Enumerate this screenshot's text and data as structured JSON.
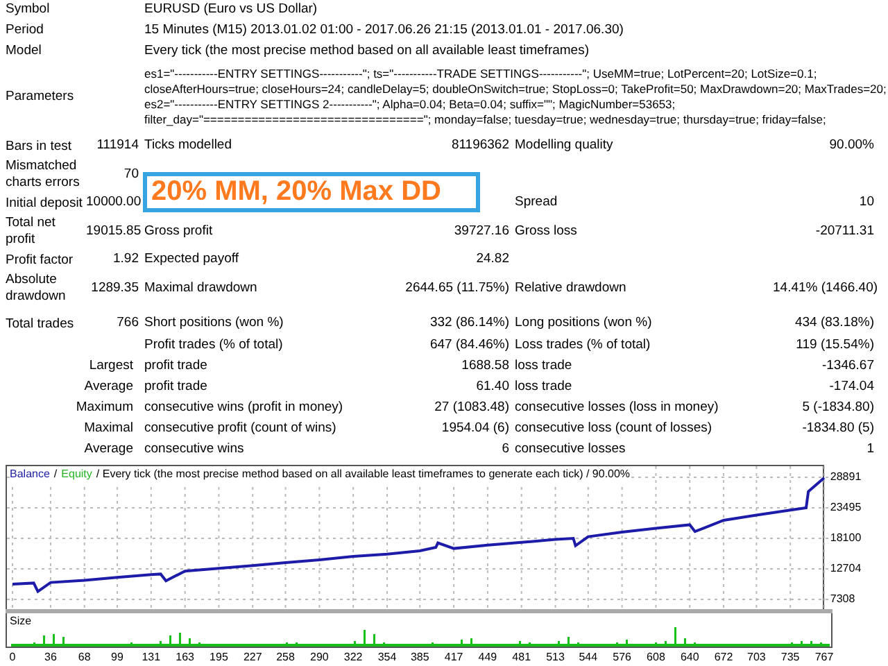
{
  "header": [
    {
      "label": "Symbol",
      "value": "EURUSD (Euro vs US Dollar)"
    },
    {
      "label": "Period",
      "value": "15 Minutes (M15) 2013.01.02 01:00 - 2017.06.26 21:15 (2013.01.01 - 2017.06.30)"
    },
    {
      "label": "Model",
      "value": "Every tick (the most precise method based on all available least timeframes)"
    }
  ],
  "parameters": {
    "label": "Parameters",
    "lines": [
      "es1=\"-----------ENTRY SETTINGS-----------\"; ts=\"-----------TRADE SETTINGS-----------\"; UseMM=true; LotPercent=20; LotSize=0.1;",
      "closeAfterHours=true; closeHours=24; candleDelay=5; doubleOnSwitch=true; StopLoss=0; TakeProfit=50; MaxDrawdown=20; MaxTrades=20;",
      "es2=\"-----------ENTRY SETTINGS 2-----------\"; Alpha=0.04; Beta=0.04; suffix=\"\"; MagicNumber=53653;",
      "filter_day=\"================================\"; monday=false; tuesday=true; wednesday=true; thursday=true; friday=false;"
    ]
  },
  "banner": "20% MM, 20% Max DD",
  "stats": [
    {
      "kind": "main",
      "label": "Bars in test",
      "value": "111914",
      "label_2": "Ticks modelled",
      "value_2": "81196362",
      "label_3": "Modelling quality",
      "value_3": "90.00%"
    },
    {
      "kind": "main",
      "label": "Mismatched charts errors",
      "value": "70"
    },
    {
      "kind": "main",
      "label": "Initial deposit",
      "value": "10000.00",
      "label_3": "Spread",
      "value_3": "10"
    },
    {
      "kind": "main",
      "label": "Total net profit",
      "value": "19015.85",
      "label_2": "Gross profit",
      "value_2": "39727.16",
      "label_3": "Gross loss",
      "value_3": "-20711.31"
    },
    {
      "kind": "main",
      "label": "Profit factor",
      "value": "1.92",
      "label_2": "Expected payoff",
      "value_2": "24.82"
    },
    {
      "kind": "main",
      "label": "Absolute drawdown",
      "value": "1289.35",
      "label_2": "Maximal drawdown",
      "value_2": "2644.65 (11.75%)",
      "label_3": "Relative drawdown",
      "value_3": "14.41% (1466.40)"
    },
    {
      "kind": "main",
      "label": "Total trades",
      "value": "766",
      "label_2": "Short positions (won %)",
      "value_2": "332 (86.14%)",
      "label_3": "Long positions (won %)",
      "value_3": "434 (83.18%)"
    },
    {
      "kind": "sub",
      "label_2": "Profit trades (% of total)",
      "value_2": "647 (84.46%)",
      "label_3": "Loss trades (% of total)",
      "value_3": "119 (15.54%)"
    },
    {
      "kind": "sub",
      "label": "Largest",
      "label_2": "profit trade",
      "value_2": "1688.58",
      "label_3": "loss trade",
      "value_3": "-1346.67"
    },
    {
      "kind": "sub",
      "label": "Average",
      "label_2": "profit trade",
      "value_2": "61.40",
      "label_3": "loss trade",
      "value_3": "-174.04"
    },
    {
      "kind": "sub",
      "label": "Maximum",
      "label_2": "consecutive wins (profit in money)",
      "value_2": "27 (1083.48)",
      "label_3": "consecutive losses (loss in money)",
      "value_3": "5 (-1834.80)"
    },
    {
      "kind": "sub",
      "label": "Maximal",
      "label_2": "consecutive profit (count of wins)",
      "value_2": "1954.04 (6)",
      "label_3": "consecutive loss (count of losses)",
      "value_3": "-1834.80 (5)"
    },
    {
      "kind": "sub",
      "label": "Average",
      "label_2": "consecutive wins",
      "value_2": "6",
      "label_3": "consecutive losses",
      "value_3": "1"
    }
  ],
  "chart": {
    "separator": "/",
    "equity_legend": {
      "name": "Equity",
      "color": "#22b522"
    },
    "size_label": "Size",
    "chart_data": {
      "type": "line",
      "title": "Every tick (the most precise method based on all available least timeframes to generate each tick) / 90.00%",
      "x": [
        0,
        20,
        24,
        36,
        68,
        99,
        131,
        140,
        145,
        163,
        195,
        227,
        258,
        290,
        322,
        354,
        385,
        400,
        402,
        417,
        449,
        481,
        513,
        530,
        532,
        544,
        576,
        608,
        640,
        645,
        672,
        703,
        735,
        750,
        752,
        767
      ],
      "series": [
        {
          "name": "Balance",
          "color": "#1c1ca8",
          "values": [
            10000,
            10200,
            8700,
            10300,
            10700,
            11200,
            11700,
            11800,
            10600,
            12300,
            12800,
            13300,
            13800,
            14300,
            14900,
            15300,
            15900,
            16500,
            17300,
            16300,
            16900,
            17400,
            17900,
            18100,
            16800,
            18400,
            19200,
            19900,
            20500,
            19300,
            21300,
            22200,
            23100,
            23500,
            26400,
            28800
          ]
        }
      ],
      "grid": true,
      "xlim": [
        0,
        767
      ],
      "ylim": [
        7308,
        28891
      ],
      "xticks": [
        0,
        36,
        68,
        99,
        131,
        163,
        195,
        227,
        258,
        290,
        322,
        354,
        385,
        417,
        449,
        481,
        513,
        544,
        576,
        608,
        640,
        672,
        703,
        735,
        767
      ],
      "yticks": [
        7308,
        12704,
        18100,
        23495,
        28891
      ]
    }
  }
}
